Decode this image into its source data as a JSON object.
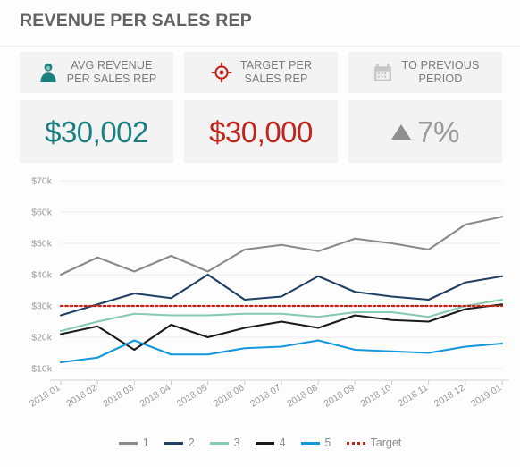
{
  "header": {
    "title": "REVENUE PER SALES REP"
  },
  "kpis": [
    {
      "icon": "person-icon",
      "icon_color": "#1a7f7f",
      "label": "AVG REVENUE\nPER SALES REP",
      "value": "$30,002",
      "value_color": "#1a7f7f",
      "value_style": "teal"
    },
    {
      "icon": "target-icon",
      "icon_color": "#c0241b",
      "label": "TARGET PER\nSALES REP",
      "value": "$30,000",
      "value_color": "#c0241b",
      "value_style": "red"
    },
    {
      "icon": "calendar-icon",
      "icon_color": "#c6c6c6",
      "label": "TO PREVIOUS\nPERIOD",
      "value": "7%",
      "value_color": "#9a9a9a",
      "value_style": "gray",
      "trend": "up"
    }
  ],
  "chart_data": {
    "type": "line",
    "title": "REVENUE PER SALES REP",
    "xlabel": "",
    "ylabel": "",
    "ylim": [
      5000,
      70000
    ],
    "ytick_values": [
      10000,
      20000,
      30000,
      40000,
      50000,
      60000,
      70000
    ],
    "ytick_labels": [
      "$10k",
      "$20k",
      "$30k",
      "$40k",
      "$50k",
      "$60k",
      "$70k"
    ],
    "grid": true,
    "legend_position": "bottom",
    "categories": [
      "2018 01",
      "2018 02",
      "2018 03",
      "2018 04",
      "2018 05",
      "2018 06",
      "2018 07",
      "2018 08",
      "2018 09",
      "2018 10",
      "2018 11",
      "2018 12",
      "2019 01"
    ],
    "series": [
      {
        "name": "1",
        "color": "#8a8a8a",
        "values": [
          40000,
          45500,
          41000,
          46000,
          41000,
          48000,
          49500,
          47500,
          51500,
          50000,
          48000,
          56000,
          58500
        ]
      },
      {
        "name": "2",
        "color": "#1f3f63",
        "values": [
          27000,
          30500,
          34000,
          32500,
          40000,
          32000,
          33000,
          39500,
          34500,
          33000,
          32000,
          37500,
          39500
        ]
      },
      {
        "name": "3",
        "color": "#84cbb0",
        "values": [
          22000,
          25000,
          27500,
          27000,
          27000,
          27500,
          27500,
          26500,
          28000,
          28000,
          26500,
          30000,
          32000
        ]
      },
      {
        "name": "4",
        "color": "#1a1a1a",
        "values": [
          21000,
          23500,
          16000,
          24000,
          20000,
          23000,
          25000,
          23000,
          27000,
          25500,
          25000,
          29000,
          30500
        ]
      },
      {
        "name": "5",
        "color": "#1497dd",
        "values": [
          12000,
          13500,
          19000,
          14500,
          14500,
          16500,
          17000,
          19000,
          16000,
          15500,
          15000,
          17000,
          18000
        ]
      }
    ],
    "target": {
      "name": "Target",
      "color": "#c0241b",
      "value": 30000,
      "style": "dotted"
    },
    "legend": [
      {
        "label": "1",
        "color": "#8a8a8a",
        "style": "solid"
      },
      {
        "label": "2",
        "color": "#1f3f63",
        "style": "solid"
      },
      {
        "label": "3",
        "color": "#84cbb0",
        "style": "solid"
      },
      {
        "label": "4",
        "color": "#1a1a1a",
        "style": "solid"
      },
      {
        "label": "5",
        "color": "#1497dd",
        "style": "solid"
      },
      {
        "label": "Target",
        "color": "#c0241b",
        "style": "dotted"
      }
    ]
  }
}
